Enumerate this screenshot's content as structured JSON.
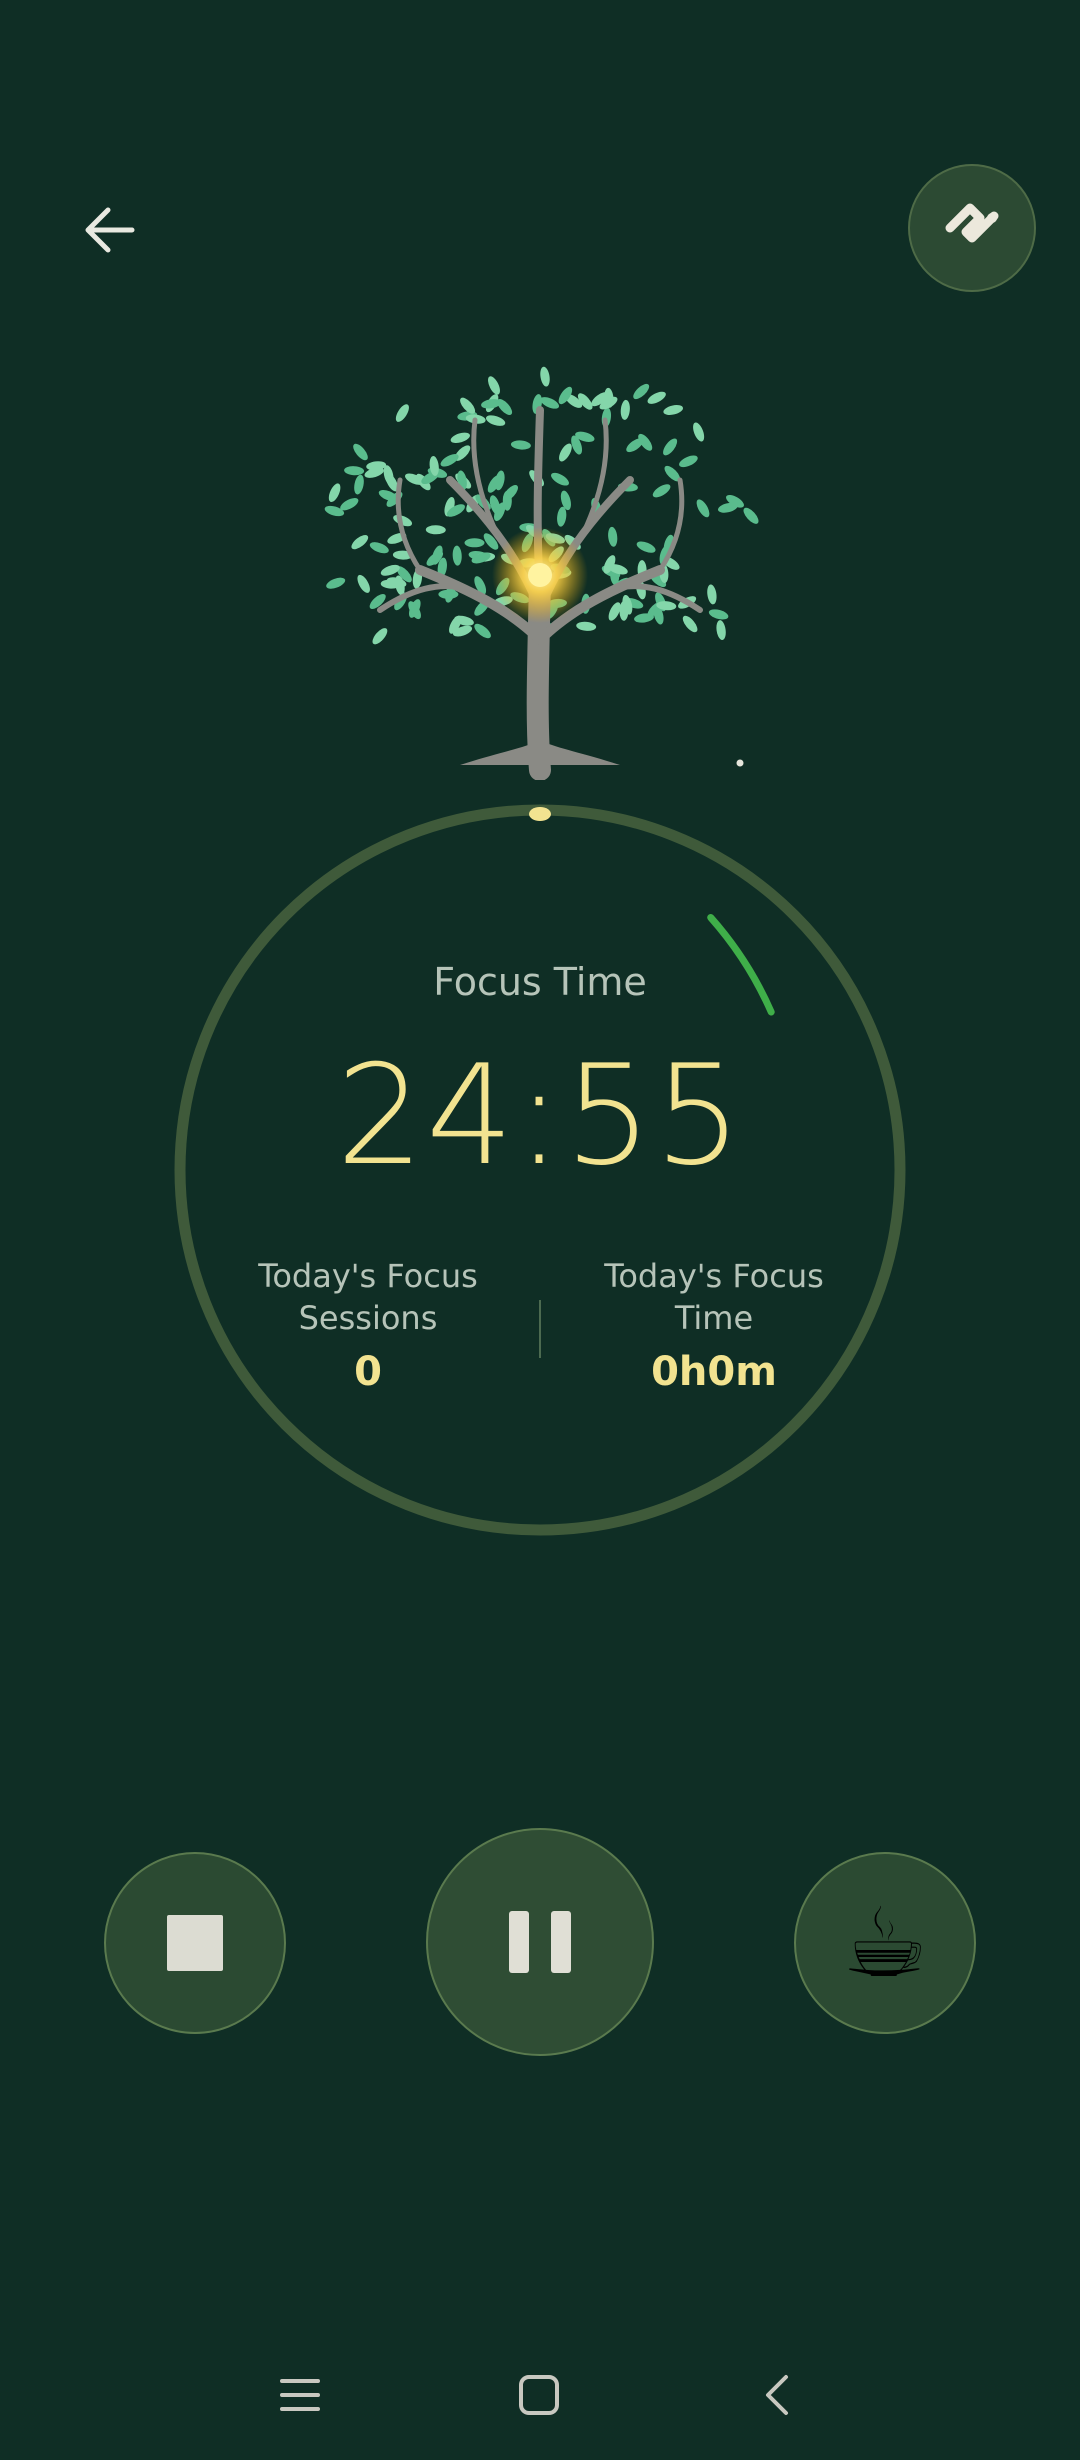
{
  "header": {
    "back_icon": "arrow-left-icon",
    "settings_icon": "diamond-toggle-icon"
  },
  "tree": {
    "icon": "glowing-tree-icon",
    "glow_color": "#ffd54a",
    "leaf_color": "#7fd9a8"
  },
  "timer": {
    "label": "Focus Time",
    "value": "24:55",
    "progress_fraction": 0.0033,
    "ring_color": "#3f5a3a",
    "arc_color": "#3fae49",
    "marker_color": "#f2e390"
  },
  "stats": {
    "sessions": {
      "label_line1": "Today's Focus",
      "label_line2": "Sessions",
      "value": "0"
    },
    "time": {
      "label_line1": "Today's Focus",
      "label_line2": "Time",
      "value": "0h0m"
    }
  },
  "controls": {
    "stop_icon": "stop-icon",
    "pause_icon": "pause-icon",
    "break_icon": "coffee-cup-icon",
    "break_glyph": "☕"
  },
  "nav": {
    "recents_icon": "recents-icon",
    "home_icon": "home-icon",
    "back_icon": "nav-back-icon"
  },
  "colors": {
    "background": "#0f2e25",
    "accent_yellow": "#f2e390",
    "accent_green": "#3fae49"
  }
}
